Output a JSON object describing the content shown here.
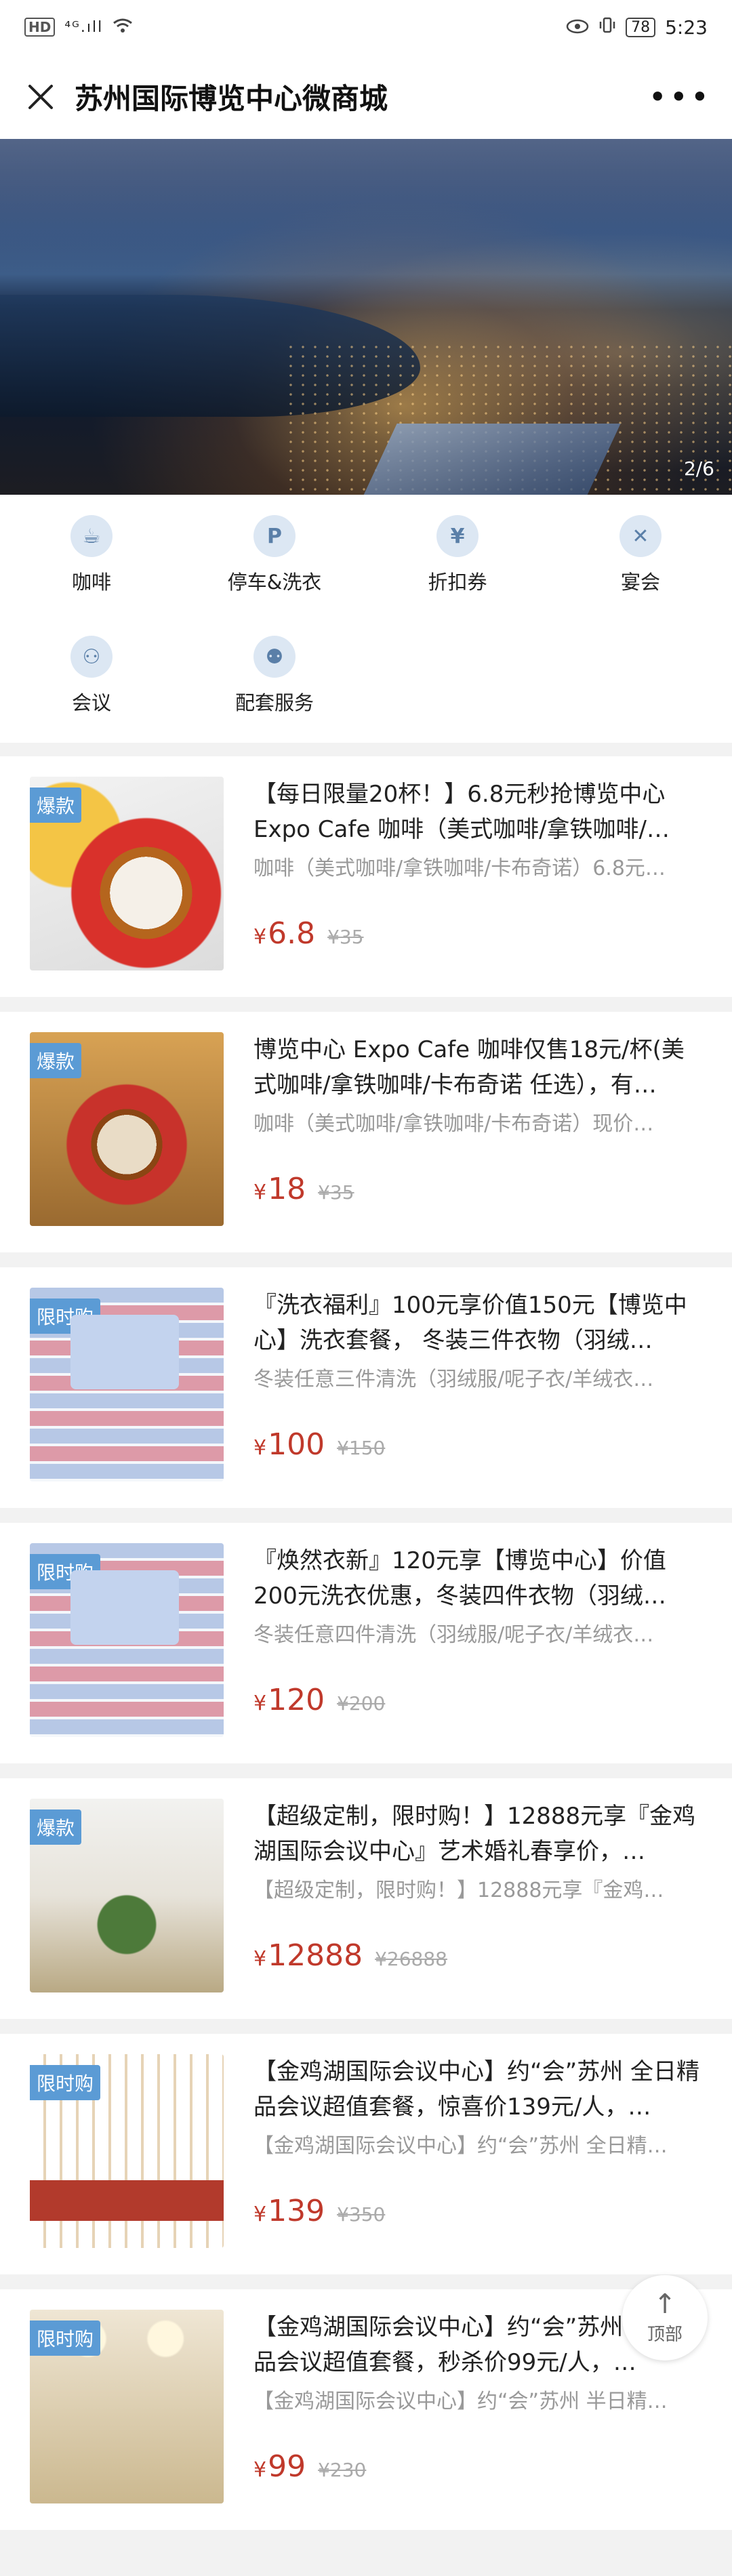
{
  "status_bar": {
    "net_label": "HD",
    "signal": "⁴ᴳ.ıll",
    "battery": "78",
    "time": "5:23"
  },
  "navbar": {
    "close_icon": "close-icon",
    "title": "苏州国际博览中心微商城",
    "more": "•••"
  },
  "banner": {
    "indicator": "2/6"
  },
  "categories": [
    {
      "label": "咖啡",
      "icon": "coffee-icon",
      "glyph": "☕"
    },
    {
      "label": "停车&洗衣",
      "icon": "parking-icon",
      "glyph": "P"
    },
    {
      "label": "折扣券",
      "icon": "coupon-icon",
      "glyph": "¥"
    },
    {
      "label": "宴会",
      "icon": "banquet-icon",
      "glyph": "✕"
    },
    {
      "label": "会议",
      "icon": "meeting-icon",
      "glyph": "⚇"
    },
    {
      "label": "配套服务",
      "icon": "service-icon",
      "glyph": "⚉"
    }
  ],
  "products": [
    {
      "badge": "爆款",
      "title": "【每日限量20杯！】6.8元秒抢博览中心Expo Cafe 咖啡（美式咖啡/拿铁咖啡/…",
      "subtitle": "咖啡（美式咖啡/拿铁咖啡/卡布奇诺）6.8元…",
      "currency": "¥",
      "price": "6.8",
      "original": "¥35"
    },
    {
      "badge": "爆款",
      "title": "博览中心 Expo Cafe 咖啡仅售18元/杯(美式咖啡/拿铁咖啡/卡布奇诺 任选），有…",
      "subtitle": "咖啡（美式咖啡/拿铁咖啡/卡布奇诺）现价…",
      "currency": "¥",
      "price": "18",
      "original": "¥35"
    },
    {
      "badge": "限时购",
      "title": "『洗衣福利』100元享价值150元【博览中心】洗衣套餐， 冬装三件衣物（羽绒…",
      "subtitle": "冬装任意三件清洗（羽绒服/呢子衣/羊绒衣…",
      "currency": "¥",
      "price": "100",
      "original": "¥150"
    },
    {
      "badge": "限时购",
      "title": "『焕然衣新』120元享【博览中心】价值200元洗衣优惠，冬装四件衣物（羽绒…",
      "subtitle": "冬装任意四件清洗（羽绒服/呢子衣/羊绒衣…",
      "currency": "¥",
      "price": "120",
      "original": "¥200"
    },
    {
      "badge": "爆款",
      "title": "【超级定制，限时购！】12888元享『金鸡湖国际会议中心』艺术婚礼春享价，…",
      "subtitle": "【超级定制，限时购！】12888元享『金鸡…",
      "currency": "¥",
      "price": "12888",
      "original": "¥26888"
    },
    {
      "badge": "限时购",
      "title": "【金鸡湖国际会议中心】约“会”苏州 全日精品会议超值套餐，惊喜价139元/人，…",
      "subtitle": "【金鸡湖国际会议中心】约“会”苏州 全日精…",
      "currency": "¥",
      "price": "139",
      "original": "¥350"
    },
    {
      "badge": "限时购",
      "title": "【金鸡湖国际会议中心】约“会”苏州 半日精品会议超值套餐，秒杀价99元/人，…",
      "subtitle": "【金鸡湖国际会议中心】约“会”苏州 半日精…",
      "currency": "¥",
      "price": "99",
      "original": "¥230"
    }
  ],
  "back_to_top": {
    "arrow": "↑",
    "label": "顶部"
  }
}
